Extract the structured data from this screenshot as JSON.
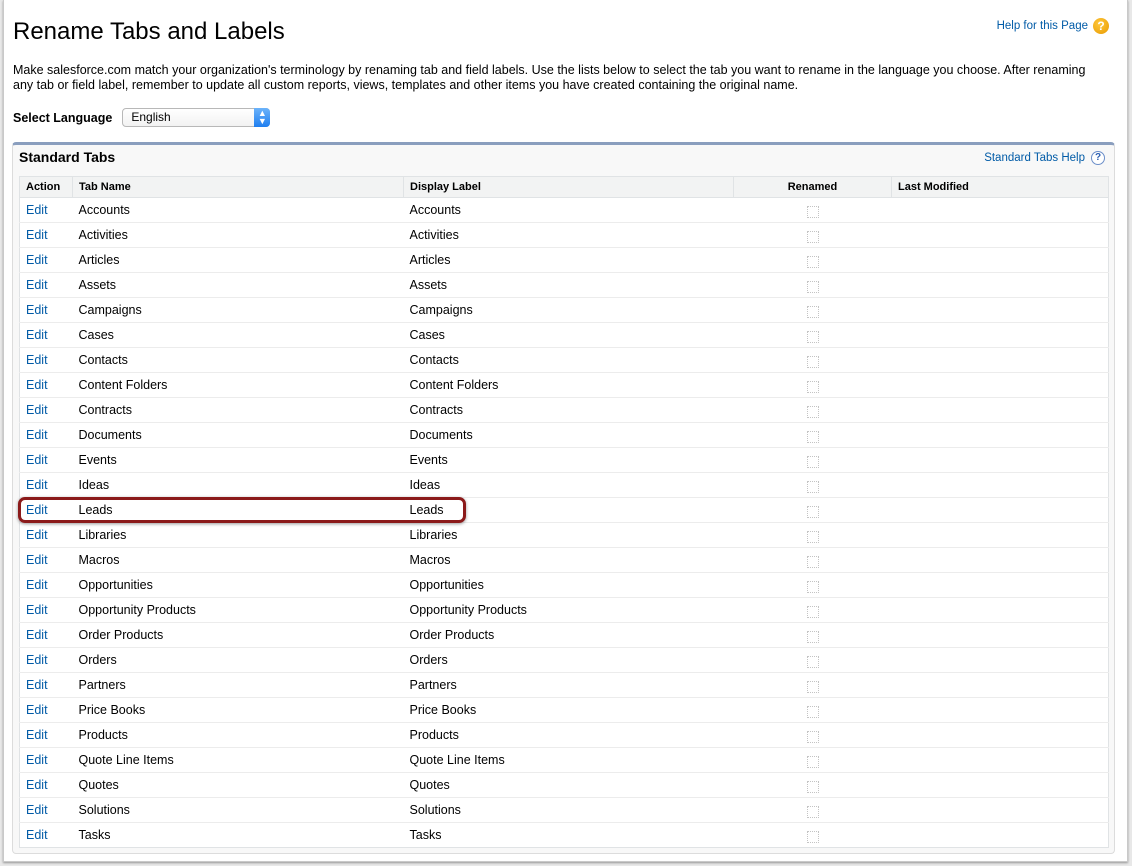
{
  "page": {
    "title": "Rename Tabs and Labels",
    "help_link": "Help for this Page",
    "description": "Make salesforce.com match your organization's terminology by renaming tab and field labels. Use the lists below to select the tab you want to rename in the language you choose. After renaming any tab or field label, remember to update all custom reports, views, templates and other items you have created containing the original name.",
    "language_label": "Select Language",
    "language_value": "English"
  },
  "panel": {
    "title": "Standard Tabs",
    "help_link": "Standard Tabs Help",
    "columns": [
      "Action",
      "Tab Name",
      "Display Label",
      "Renamed",
      "Last Modified"
    ],
    "rows": [
      {
        "action": "Edit",
        "tab_name": "Accounts",
        "display_label": "Accounts",
        "renamed": false,
        "last_modified": ""
      },
      {
        "action": "Edit",
        "tab_name": "Activities",
        "display_label": "Activities",
        "renamed": false,
        "last_modified": ""
      },
      {
        "action": "Edit",
        "tab_name": "Articles",
        "display_label": "Articles",
        "renamed": false,
        "last_modified": ""
      },
      {
        "action": "Edit",
        "tab_name": "Assets",
        "display_label": "Assets",
        "renamed": false,
        "last_modified": ""
      },
      {
        "action": "Edit",
        "tab_name": "Campaigns",
        "display_label": "Campaigns",
        "renamed": false,
        "last_modified": ""
      },
      {
        "action": "Edit",
        "tab_name": "Cases",
        "display_label": "Cases",
        "renamed": false,
        "last_modified": ""
      },
      {
        "action": "Edit",
        "tab_name": "Contacts",
        "display_label": "Contacts",
        "renamed": false,
        "last_modified": ""
      },
      {
        "action": "Edit",
        "tab_name": "Content Folders",
        "display_label": "Content Folders",
        "renamed": false,
        "last_modified": ""
      },
      {
        "action": "Edit",
        "tab_name": "Contracts",
        "display_label": "Contracts",
        "renamed": false,
        "last_modified": ""
      },
      {
        "action": "Edit",
        "tab_name": "Documents",
        "display_label": "Documents",
        "renamed": false,
        "last_modified": ""
      },
      {
        "action": "Edit",
        "tab_name": "Events",
        "display_label": "Events",
        "renamed": false,
        "last_modified": ""
      },
      {
        "action": "Edit",
        "tab_name": "Ideas",
        "display_label": "Ideas",
        "renamed": false,
        "last_modified": ""
      },
      {
        "action": "Edit",
        "tab_name": "Leads",
        "display_label": "Leads",
        "renamed": false,
        "last_modified": "",
        "highlighted": true
      },
      {
        "action": "Edit",
        "tab_name": "Libraries",
        "display_label": "Libraries",
        "renamed": false,
        "last_modified": ""
      },
      {
        "action": "Edit",
        "tab_name": "Macros",
        "display_label": "Macros",
        "renamed": false,
        "last_modified": ""
      },
      {
        "action": "Edit",
        "tab_name": "Opportunities",
        "display_label": "Opportunities",
        "renamed": false,
        "last_modified": ""
      },
      {
        "action": "Edit",
        "tab_name": "Opportunity Products",
        "display_label": "Opportunity Products",
        "renamed": false,
        "last_modified": ""
      },
      {
        "action": "Edit",
        "tab_name": "Order Products",
        "display_label": "Order Products",
        "renamed": false,
        "last_modified": ""
      },
      {
        "action": "Edit",
        "tab_name": "Orders",
        "display_label": "Orders",
        "renamed": false,
        "last_modified": ""
      },
      {
        "action": "Edit",
        "tab_name": "Partners",
        "display_label": "Partners",
        "renamed": false,
        "last_modified": ""
      },
      {
        "action": "Edit",
        "tab_name": "Price Books",
        "display_label": "Price Books",
        "renamed": false,
        "last_modified": ""
      },
      {
        "action": "Edit",
        "tab_name": "Products",
        "display_label": "Products",
        "renamed": false,
        "last_modified": ""
      },
      {
        "action": "Edit",
        "tab_name": "Quote Line Items",
        "display_label": "Quote Line Items",
        "renamed": false,
        "last_modified": ""
      },
      {
        "action": "Edit",
        "tab_name": "Quotes",
        "display_label": "Quotes",
        "renamed": false,
        "last_modified": ""
      },
      {
        "action": "Edit",
        "tab_name": "Solutions",
        "display_label": "Solutions",
        "renamed": false,
        "last_modified": ""
      },
      {
        "action": "Edit",
        "tab_name": "Tasks",
        "display_label": "Tasks",
        "renamed": false,
        "last_modified": ""
      }
    ]
  },
  "colors": {
    "link": "#015ba7",
    "panel_accent": "#8a9ebe",
    "highlight": "#8b1a1a"
  }
}
